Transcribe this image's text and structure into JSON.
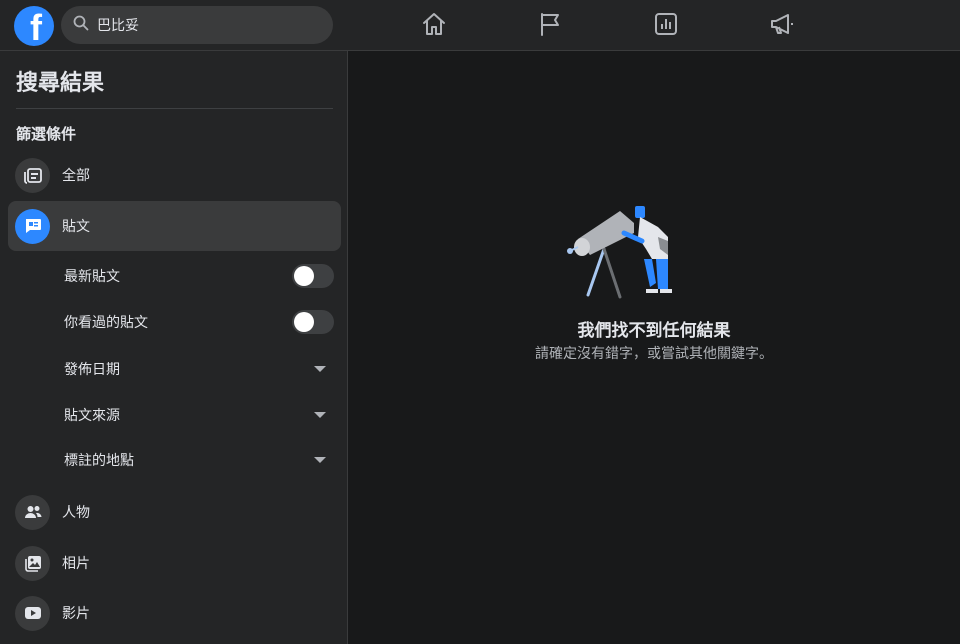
{
  "header": {
    "logo_letter": "f",
    "search_value": "巴比妥",
    "nav_icons": [
      "home-icon",
      "flag-icon",
      "chart-icon",
      "megaphone-icon"
    ]
  },
  "sidebar": {
    "title": "搜尋結果",
    "filters_heading": "篩選條件",
    "items": [
      {
        "label": "全部",
        "icon": "all-feed-icon",
        "active": false
      },
      {
        "label": "貼文",
        "icon": "posts-icon",
        "active": true
      },
      {
        "label": "人物",
        "icon": "people-icon",
        "active": false
      },
      {
        "label": "相片",
        "icon": "photos-icon",
        "active": false
      },
      {
        "label": "影片",
        "icon": "video-icon",
        "active": false
      }
    ],
    "post_filters": [
      {
        "label": "最新貼文",
        "type": "toggle",
        "on": false
      },
      {
        "label": "你看過的貼文",
        "type": "toggle",
        "on": false
      },
      {
        "label": "發佈日期",
        "type": "dropdown"
      },
      {
        "label": "貼文來源",
        "type": "dropdown"
      },
      {
        "label": "標註的地點",
        "type": "dropdown"
      }
    ]
  },
  "main": {
    "empty_title": "我們找不到任何結果",
    "empty_subtitle": "請確定沒有錯字，或嘗試其他關鍵字。"
  },
  "colors": {
    "background": "#18191a",
    "surface": "#242526",
    "hover": "#3a3b3c",
    "accent": "#2d88ff",
    "text_primary": "#e4e6eb",
    "text_secondary": "#b0b3b8"
  }
}
